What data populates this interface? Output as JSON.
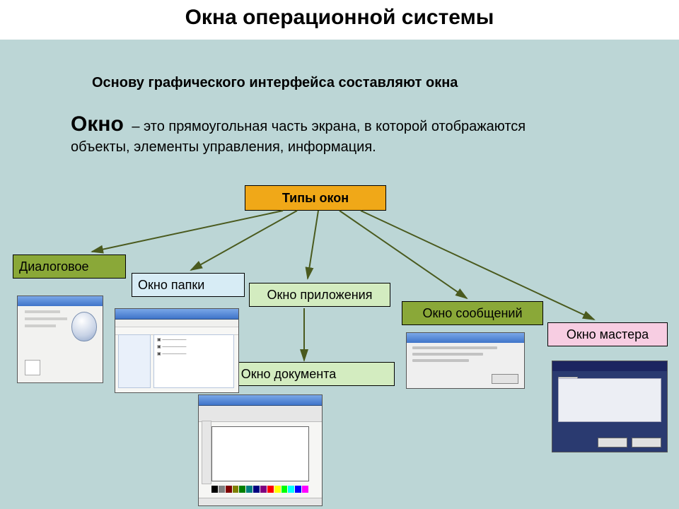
{
  "title": "Окна операционной системы",
  "intro": "Основу графического интерфейса составляют окна",
  "def_keyword": "Окно",
  "def_rest": " – это прямоугольная часть экрана, в которой отображаются объекты, элементы управления, информация.",
  "root": "Типы окон",
  "nodes": {
    "dialog": "Диалоговое",
    "folder": "Окно папки",
    "app": "Окно приложения",
    "msg": "Окно сообщений",
    "wizard": "Окно мастера",
    "doc": "Окно документа"
  },
  "palette": [
    "#000000",
    "#808080",
    "#800000",
    "#808000",
    "#008000",
    "#008080",
    "#000080",
    "#800080",
    "#ff0000",
    "#ffff00",
    "#00ff00",
    "#00ffff",
    "#0000ff",
    "#ff00ff"
  ]
}
